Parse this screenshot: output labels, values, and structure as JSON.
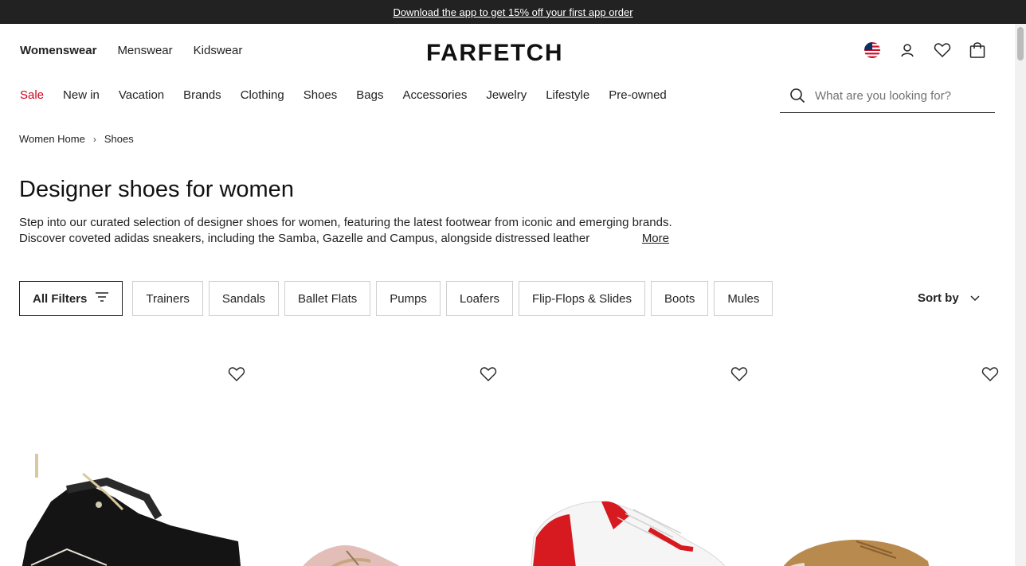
{
  "promo": {
    "text": "Download the app to get 15% off your first app order"
  },
  "header": {
    "genders": [
      "Womenswear",
      "Menswear",
      "Kidswear"
    ],
    "logo": "FARFETCH"
  },
  "nav": {
    "items": [
      "Sale",
      "New in",
      "Vacation",
      "Brands",
      "Clothing",
      "Shoes",
      "Bags",
      "Accessories",
      "Jewelry",
      "Lifestyle",
      "Pre-owned"
    ]
  },
  "search": {
    "placeholder": "What are you looking for?"
  },
  "breadcrumb": {
    "home": "Women Home",
    "sep": "›",
    "current": "Shoes"
  },
  "page": {
    "title": "Designer shoes for women",
    "description": "Step into our curated selection of designer shoes for women, featuring the latest footwear from iconic and emerging brands. Discover coveted adidas sneakers, including the Samba, Gazelle and Campus, alongside distressed leather",
    "more": "More"
  },
  "filters": {
    "all": "All Filters",
    "chips": [
      "Trainers",
      "Sandals",
      "Ballet Flats",
      "Pumps",
      "Loafers",
      "Flip-Flops & Slides",
      "Boots",
      "Mules"
    ],
    "sort": "Sort by"
  },
  "colors": {
    "sale": "#d0021b",
    "promo_bg": "#222222"
  }
}
